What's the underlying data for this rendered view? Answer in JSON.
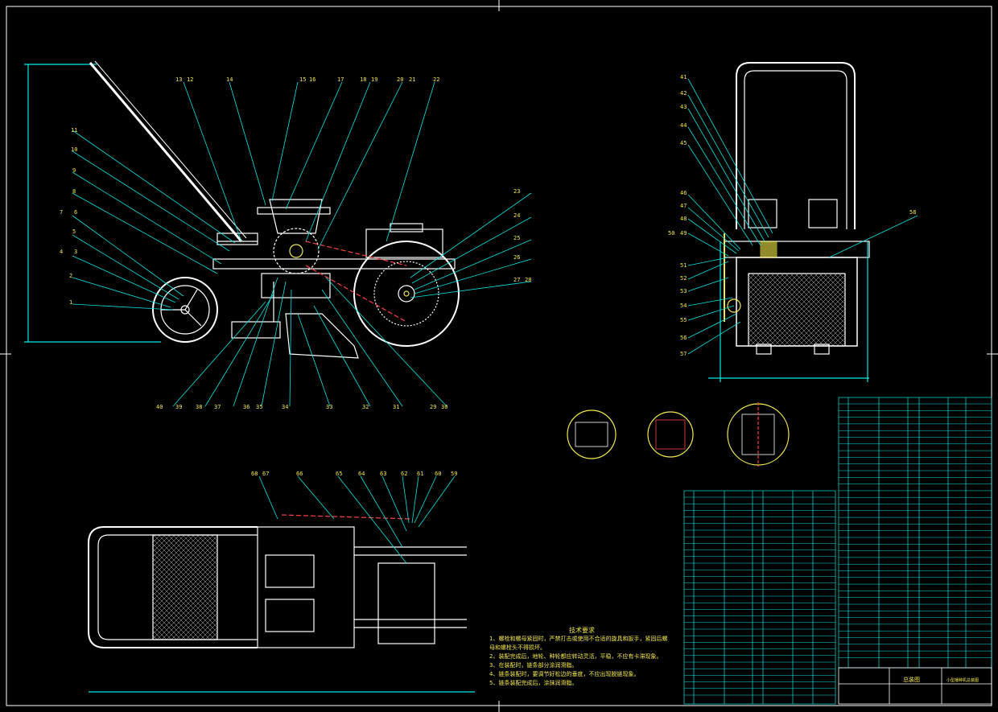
{
  "drawing": {
    "front_view_labels": [
      "1",
      "2",
      "3",
      "4",
      "5",
      "6",
      "7",
      "8",
      "9",
      "10",
      "11",
      "12",
      "13",
      "14",
      "15",
      "16",
      "17",
      "18",
      "19",
      "20",
      "21",
      "22",
      "23",
      "24",
      "25",
      "26",
      "27",
      "28",
      "29",
      "30",
      "31",
      "32",
      "33",
      "34",
      "35",
      "36",
      "37",
      "38",
      "39",
      "40"
    ],
    "side_view_labels": [
      "41",
      "42",
      "43",
      "44",
      "45",
      "46",
      "47",
      "48",
      "49",
      "50",
      "51",
      "52",
      "53",
      "54",
      "55",
      "56",
      "57",
      "58"
    ],
    "top_view_labels": [
      "59",
      "60",
      "61",
      "62",
      "63",
      "64",
      "65",
      "66",
      "67",
      "68"
    ],
    "tech_title": "技术要求",
    "tech_lines": [
      "1、螺栓和螺母紧固时，严禁打击或使用不合适的旋具和扳手，紧固后螺",
      "   母和螺栓头不得损坏。",
      "2、装配完成后，地轮、种轮都应转动灵活，平稳，不应有卡滞现象。",
      "3、在装配时，链条部分涂润滑脂。",
      "4、链条装配时，要调节好松边的垂度，不应出现脱链现象。",
      "5、链条装配完成后，涂抹润滑脂。"
    ],
    "title_block_name": "总装图",
    "title_block_subtitle": "小型播种机总装图"
  },
  "colors": {
    "background": "#000000",
    "outline": "#ffffff",
    "leader": "#00e5e5",
    "accent": "#f2e84a",
    "hatch": "#ff4040"
  }
}
